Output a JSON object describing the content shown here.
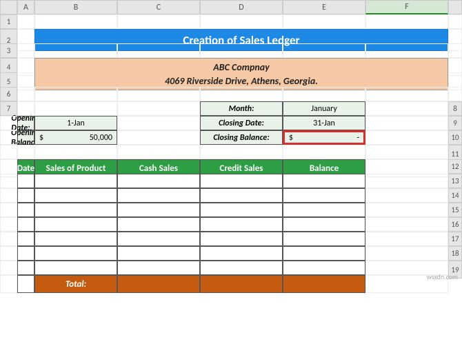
{
  "columns": [
    "A",
    "B",
    "C",
    "D",
    "E",
    "F",
    ""
  ],
  "rows": [
    "1",
    "2",
    "3",
    "4",
    "5",
    "6",
    "7",
    "8",
    "9",
    "10",
    "11",
    "12",
    "13",
    "14",
    "15",
    "16",
    "17",
    "18",
    "19"
  ],
  "title": "Creation of Sales Ledger",
  "company": {
    "name": "ABC Compnay",
    "address": "4069 Riverside Drive, Athens, Georgia."
  },
  "opening": {
    "date_label": "Opening Date:",
    "date_value": "1-Jan",
    "balance_label": "Opening Balance:",
    "balance_currency": "$",
    "balance_value": "50,000"
  },
  "closing": {
    "month_label": "Month:",
    "month_value": "January",
    "date_label": "Closing Date:",
    "date_value": "31-Jan",
    "balance_label": "Closing Balance:",
    "balance_currency": "$",
    "balance_value": "-"
  },
  "table": {
    "headers": [
      "Date",
      "Sales of Product",
      "Cash Sales",
      "Credit Sales",
      "Balance"
    ],
    "total_label": "Total:"
  },
  "watermark": "wsxdn.com",
  "active_col": "F"
}
